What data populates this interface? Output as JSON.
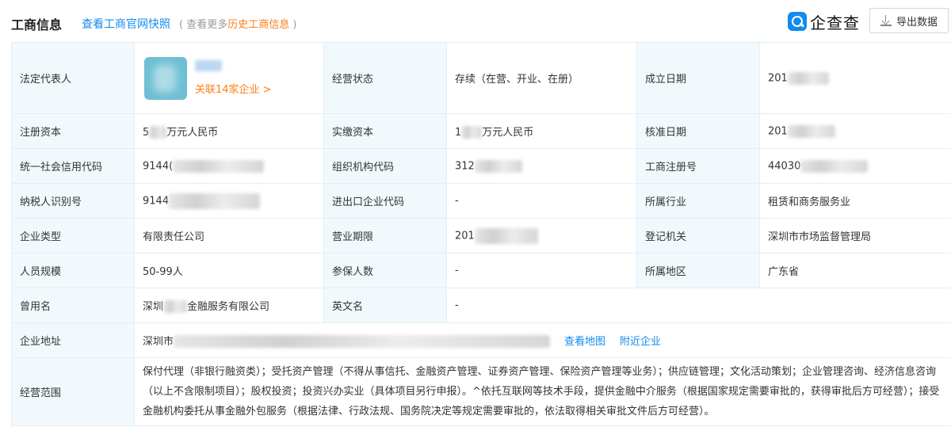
{
  "header": {
    "title": "工商信息",
    "snapshot_link": "查看工商官网快照",
    "sub_prefix": "( 查看更多",
    "sub_highlight": "历史工商信息",
    "sub_suffix": " )",
    "logo_text": "企查查",
    "export_label": "导出数据"
  },
  "rows": {
    "legal_rep": {
      "label": "法定代表人",
      "link": "关联14家企业 >"
    },
    "status": {
      "label": "经营状态",
      "value": "存续（在营、开业、在册）"
    },
    "est_date": {
      "label": "成立日期",
      "value": "201"
    },
    "reg_capital": {
      "label": "注册资本",
      "prefix": "5",
      "suffix": "万元人民币"
    },
    "paid_capital": {
      "label": "实缴资本",
      "prefix": "1",
      "suffix": "万元人民币"
    },
    "approve_date": {
      "label": "核准日期",
      "value": "201"
    },
    "credit_code": {
      "label": "统一社会信用代码",
      "value": "9144("
    },
    "org_code": {
      "label": "组织机构代码",
      "value": "312"
    },
    "reg_no": {
      "label": "工商注册号",
      "value": "44030"
    },
    "tax_id": {
      "label": "纳税人识别号",
      "value": "9144"
    },
    "import_code": {
      "label": "进出口企业代码",
      "value": "-"
    },
    "industry": {
      "label": "所属行业",
      "value": "租赁和商务服务业"
    },
    "company_type": {
      "label": "企业类型",
      "value": "有限责任公司"
    },
    "term": {
      "label": "营业期限",
      "value": "201"
    },
    "authority": {
      "label": "登记机关",
      "value": "深圳市市场监督管理局"
    },
    "staff": {
      "label": "人员规模",
      "value": "50-99人"
    },
    "insured": {
      "label": "参保人数",
      "value": "-"
    },
    "region": {
      "label": "所属地区",
      "value": "广东省"
    },
    "former_name": {
      "label": "曾用名",
      "prefix": "深圳",
      "suffix": "金融服务有限公司"
    },
    "english_name": {
      "label": "英文名",
      "value": "-"
    },
    "address": {
      "label": "企业地址",
      "value": "深圳市",
      "map_link": "查看地图",
      "nearby_link": "附近企业"
    },
    "scope": {
      "label": "经营范围",
      "value": "保付代理（非银行融资类）；受托资产管理（不得从事信托、金融资产管理、证券资产管理、保险资产管理等业务）；供应链管理；文化活动策划；企业管理咨询、经济信息咨询（以上不含限制项目）；股权投资；投资兴办实业（具体项目另行申报）。^依托互联网等技术手段，提供金融中介服务（根据国家规定需要审批的，获得审批后方可经营）；接受金融机构委托从事金融外包服务（根据法律、行政法规、国务院决定等规定需要审批的，依法取得相关审批文件后方可经营）。"
    }
  }
}
